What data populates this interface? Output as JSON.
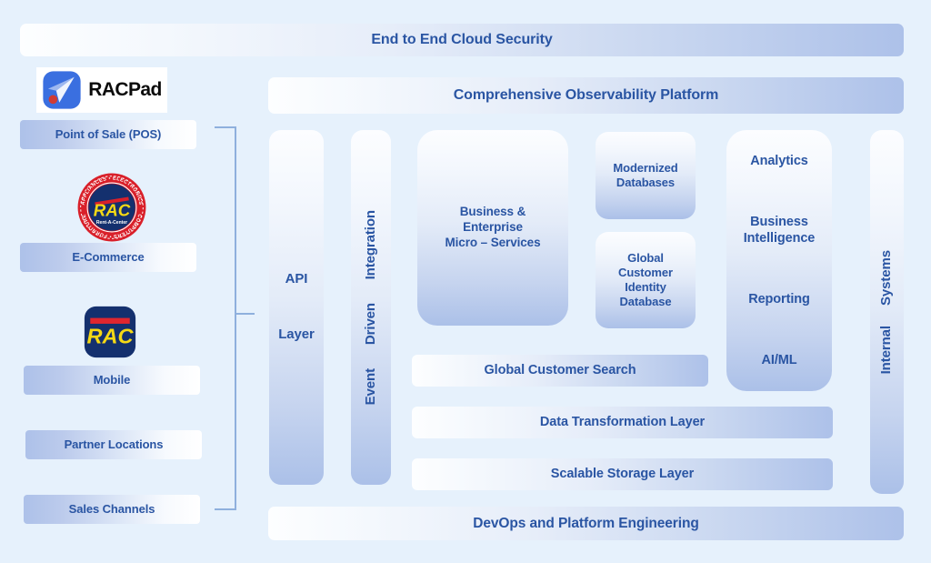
{
  "background_color": "#e6f1fc",
  "accent_text_color": "#2a55a3",
  "banners": {
    "top": "End to End Cloud Security",
    "observability": "Comprehensive Observability Platform",
    "devops": "DevOps and Platform Engineering"
  },
  "channels": {
    "bracket_name": "sales-channels-bracket",
    "items": [
      {
        "label": "Point of Sale (POS)",
        "icon": "racpad-logo",
        "icon_word": "RACPad"
      },
      {
        "label": "E-Commerce",
        "icon": "rac-seal-logo"
      },
      {
        "label": "Mobile",
        "icon": "rac-app-icon"
      },
      {
        "label": "Partner Locations",
        "icon": null
      },
      {
        "label": "Sales Channels",
        "icon": null
      }
    ]
  },
  "logos": {
    "racpad": {
      "word": "RACPad",
      "mark": "blue-arrow-red-dot"
    },
    "rac_seal": {
      "ring_words": "FURNITURE • APPLIANCES • ELECTRONICS • COMPUTERS",
      "center": "RAC",
      "tagline": "Rent-A-Center"
    },
    "rac_app": {
      "center": "RAC"
    }
  },
  "columns": {
    "api_layer": {
      "line1": "API",
      "line2": "Layer"
    },
    "event_driven": {
      "line1": "Integration",
      "line2": "Driven",
      "line3": "Event",
      "full": "Event Driven Integration"
    },
    "internal_systems": {
      "line1": "Systems",
      "line2": "Internal",
      "full": "Internal Systems"
    }
  },
  "core": {
    "microservices": [
      "Business &",
      "Enterprise",
      "Micro – Services"
    ],
    "modernized_databases": [
      "Modernized",
      "Databases"
    ],
    "global_identity": [
      "Global",
      "Customer",
      "Identity",
      "Database"
    ]
  },
  "analytics": {
    "items": [
      "Analytics",
      "Business\nIntelligence",
      "Reporting",
      "AI/ML"
    ],
    "item_1": "Analytics",
    "item_2_line1": "Business",
    "item_2_line2": "Intelligence",
    "item_3": "Reporting",
    "item_4": "AI/ML"
  },
  "layers": {
    "global_customer_search": "Global Customer Search",
    "data_transformation": "Data Transformation Layer",
    "scalable_storage": "Scalable Storage Layer"
  }
}
